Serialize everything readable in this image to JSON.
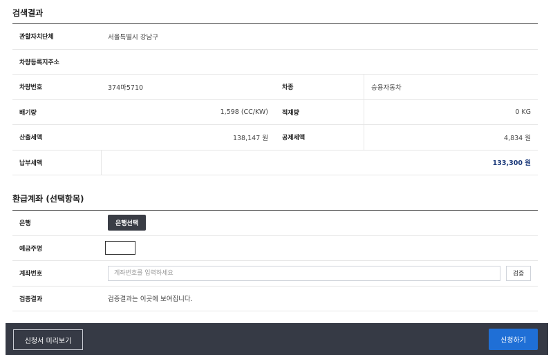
{
  "search_result": {
    "title": "검색결과",
    "rows": {
      "gov_label": "관할자치단체",
      "gov_value": "서울특별시 강남구",
      "addr_label": "차량등록지주소",
      "addr_value": "",
      "plate_label": "차량번호",
      "plate_value": "374마5710",
      "type_label": "차종",
      "type_value": "승용자동차",
      "displacement_label": "배기량",
      "displacement_value": "1,598 (CC/KW)",
      "load_label": "적재량",
      "load_value": "0 KG",
      "calc_tax_label": "산출세액",
      "calc_tax_value": "138,147 원",
      "deduct_tax_label": "공제세액",
      "deduct_tax_value": "4,834 원",
      "pay_tax_label": "납부세액",
      "pay_tax_value": "133,300 원"
    }
  },
  "refund": {
    "title": "환급계좌 (선택항목)",
    "bank_label": "은행",
    "bank_button": "은행선택",
    "holder_label": "예금주명",
    "account_label": "계좌번호",
    "account_placeholder": "계좌번호를 입력하세요",
    "verify_button": "검증",
    "verify_result_label": "검증결과",
    "verify_result_value": "검증결과는 이곳에 보여집니다."
  },
  "footer": {
    "preview_button": "신청서 미리보기",
    "apply_button": "신청하기"
  }
}
